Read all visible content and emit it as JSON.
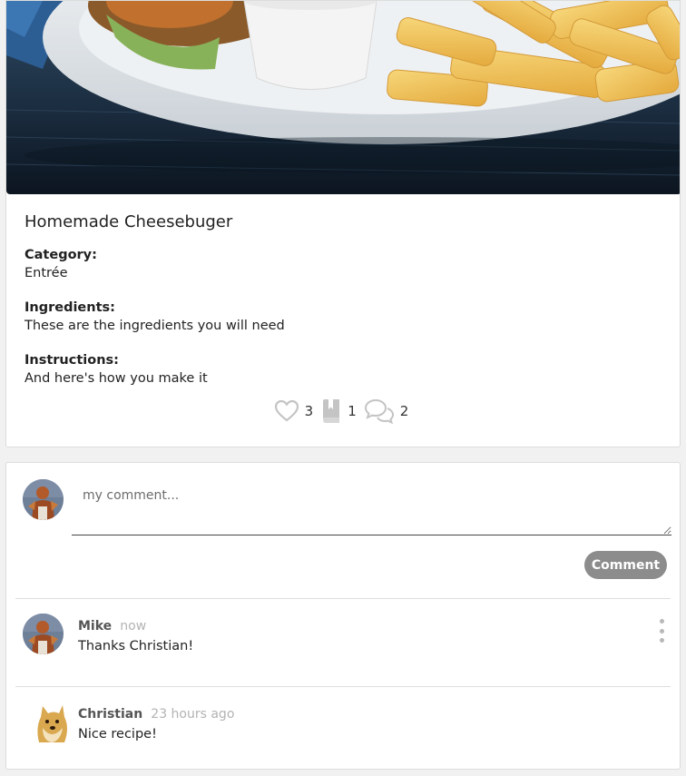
{
  "recipe": {
    "title": "Homemade Cheesebuger",
    "fields": [
      {
        "label": "Category:",
        "value": "Entrée"
      },
      {
        "label": "Ingredients:",
        "value": "These are the ingredients you will need"
      },
      {
        "label": "Instructions:",
        "value": "And here's how you make it"
      }
    ],
    "stats": {
      "likes": "3",
      "bookmarks": "1",
      "comments": "2"
    }
  },
  "comment_form": {
    "placeholder": "my comment...",
    "button_label": "Comment"
  },
  "comments": [
    {
      "author": "Mike",
      "time": "now",
      "text": "Thanks Christian!"
    },
    {
      "author": "Christian",
      "time": "23 hours ago",
      "text": "Nice recipe!"
    }
  ],
  "icons": {
    "like": "heart-icon",
    "bookmark": "book-icon",
    "comments": "speech-bubbles-icon",
    "menu": "vertical-dots-icon"
  },
  "colors": {
    "button_bg": "#8c8c8c",
    "muted_text": "#b3b3b3",
    "icon_gray": "#c4c4c4"
  }
}
